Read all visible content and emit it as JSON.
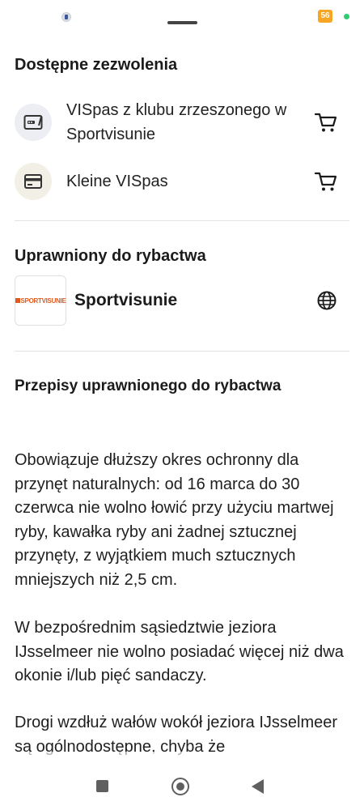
{
  "status_bar": {
    "battery_level": "56"
  },
  "permits": {
    "heading": "Dostępne zezwolenia",
    "items": [
      {
        "label": "VISpas z klubu zrzeszonego w Sportvisunie",
        "icon": "card-reader-icon",
        "action_icon": "cart-icon"
      },
      {
        "label": "Kleine VISpas",
        "icon": "credit-card-icon",
        "action_icon": "cart-icon"
      }
    ]
  },
  "fishing_rights": {
    "heading": "Uprawniony do rybactwa",
    "club": {
      "logo_text": "SPORTVISUNIE",
      "name": "Sportvisunie",
      "action_icon": "globe-icon"
    }
  },
  "rules": {
    "heading": "Przepisy uprawnionego do rybactwa",
    "paragraphs": [
      "Obowiązuje dłuższy okres ochronny dla przynęt naturalnych: od 16 marca do 30 czerwca nie wolno łowić przy użyciu martwej ryby, kawałka ryby ani żadnej sztucznej przynęty, z wyjątkiem much sztucznych mniejszych niż 2,5 cm.",
      "W bezpośrednim sąsiedztwie jeziora IJsselmeer nie wolno posiadać więcej niż dwa okonie i/lub pięć sandaczy.",
      "Drogi wzdłuż wałów wokół jeziora IJsselmeer są ogólnodostępne, chyba że"
    ]
  },
  "colors": {
    "card_icon_bg": "#eceef3",
    "card2_icon_bg": "#f1efe6",
    "logo_orange": "#e05a1c",
    "divider": "#e3e3e3"
  }
}
